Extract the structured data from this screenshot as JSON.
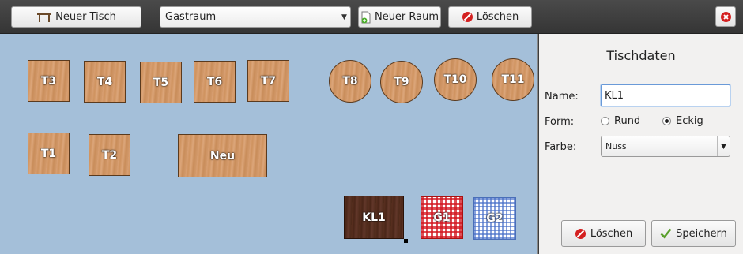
{
  "toolbar": {
    "new_table_label": "Neuer Tisch",
    "room_select_value": "Gastraum",
    "new_room_label": "Neuer Raum",
    "delete_label": "Löschen"
  },
  "canvas": {
    "tables": [
      {
        "label": "T3",
        "shape": "square",
        "style": "wood"
      },
      {
        "label": "T4",
        "shape": "square",
        "style": "wood"
      },
      {
        "label": "T5",
        "shape": "square",
        "style": "wood"
      },
      {
        "label": "T6",
        "shape": "square",
        "style": "wood"
      },
      {
        "label": "T7",
        "shape": "square",
        "style": "wood"
      },
      {
        "label": "T8",
        "shape": "round",
        "style": "wood"
      },
      {
        "label": "T9",
        "shape": "round",
        "style": "wood"
      },
      {
        "label": "T10",
        "shape": "round",
        "style": "wood"
      },
      {
        "label": "T11",
        "shape": "round",
        "style": "wood"
      },
      {
        "label": "T1",
        "shape": "square",
        "style": "wood"
      },
      {
        "label": "T2",
        "shape": "square",
        "style": "wood"
      },
      {
        "label": "Neu",
        "shape": "square",
        "style": "wood"
      },
      {
        "label": "KL1",
        "shape": "square",
        "style": "dark-wood",
        "selected": true
      },
      {
        "label": "G1",
        "shape": "square",
        "style": "red-checkered"
      },
      {
        "label": "G2",
        "shape": "square",
        "style": "blue-checkered"
      }
    ]
  },
  "panel": {
    "title": "Tischdaten",
    "name_label": "Name:",
    "name_value": "KL1",
    "form_label": "Form:",
    "form_option_round": "Rund",
    "form_option_square": "Eckig",
    "form_selected": "Eckig",
    "color_label": "Farbe:",
    "color_value": "Nuss",
    "delete_label": "Löschen",
    "save_label": "Speichern"
  },
  "colors": {
    "canvas_bg": "#a4bfd9",
    "toolbar_bg": "#3c3c3c",
    "delete_red": "#d42020",
    "save_green": "#5aa02c"
  }
}
